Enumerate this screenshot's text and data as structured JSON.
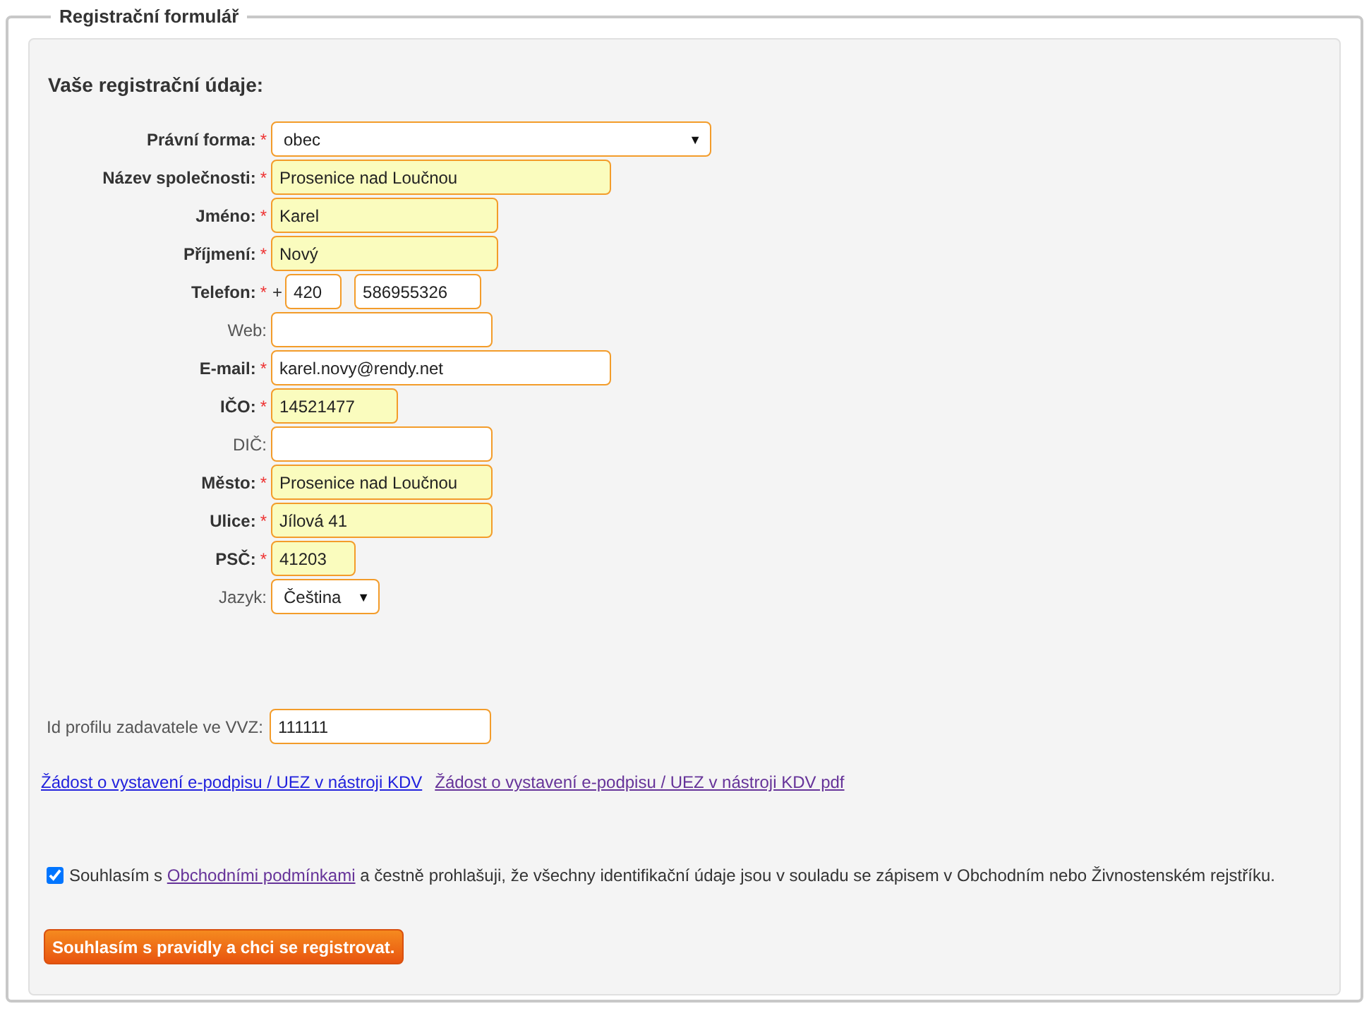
{
  "legend": "Registrační formulář",
  "heading": "Vaše registrační údaje:",
  "fields": [
    {
      "kind": "select",
      "label": "Právní forma:",
      "required": true,
      "value": "obec",
      "highlighted": false
    },
    {
      "kind": "text",
      "label": "Název společnosti:",
      "required": true,
      "value": "Prosenice nad Loučnou",
      "highlighted": true
    },
    {
      "kind": "text",
      "label": "Jméno:",
      "required": true,
      "value": "Karel",
      "highlighted": true
    },
    {
      "kind": "text",
      "label": "Příjmení:",
      "required": true,
      "value": "Nový",
      "highlighted": true
    },
    {
      "kind": "phone",
      "label": "Telefon:",
      "required": true,
      "prefix": "+",
      "code": "420",
      "value": "586955326",
      "highlighted": false
    },
    {
      "kind": "text",
      "label": "Web:",
      "required": false,
      "highlighted": false
    },
    {
      "kind": "text",
      "label": "E-mail:",
      "required": true,
      "value": "karel.novy@rendy.net",
      "highlighted": false
    },
    {
      "kind": "text",
      "label": "IČO:",
      "required": true,
      "value": "14521477",
      "highlighted": true
    },
    {
      "kind": "text",
      "label": "DIČ:",
      "required": false,
      "highlighted": false
    },
    {
      "kind": "text",
      "label": "Město:",
      "required": true,
      "value": "Prosenice nad Loučnou",
      "highlighted": true
    },
    {
      "kind": "text",
      "label": "Ulice:",
      "required": true,
      "value": "Jílová 41",
      "highlighted": true
    },
    {
      "kind": "text",
      "label": "PSČ:",
      "required": true,
      "value": "41203",
      "highlighted": true
    },
    {
      "kind": "select",
      "label": "Jazyk:",
      "required": false,
      "value": "Čeština",
      "highlighted": false
    }
  ],
  "required_mark": "*",
  "select_arrow": "▼",
  "profile": {
    "label": "Id profilu zadavatele ve VVZ:",
    "value": "111111"
  },
  "links": [
    {
      "text": "Žádost o vystavení e-podpisu / UEZ v nástroji KDV",
      "visited": false
    },
    {
      "text": "Žádost o vystavení e-podpisu / UEZ v nástroji KDV pdf",
      "visited": true
    }
  ],
  "agreement": {
    "checked": true,
    "before": "Souhlasím s ",
    "link": "Obchodními podmínkami",
    "link_visited": true,
    "after": " a čestně prohlašuji, že všechny identifikační údaje jsou v souladu se zápisem v Obchodním nebo Živnostenském rejstříku."
  },
  "submit": "Souhlasím s pravidly a chci se registrovat."
}
